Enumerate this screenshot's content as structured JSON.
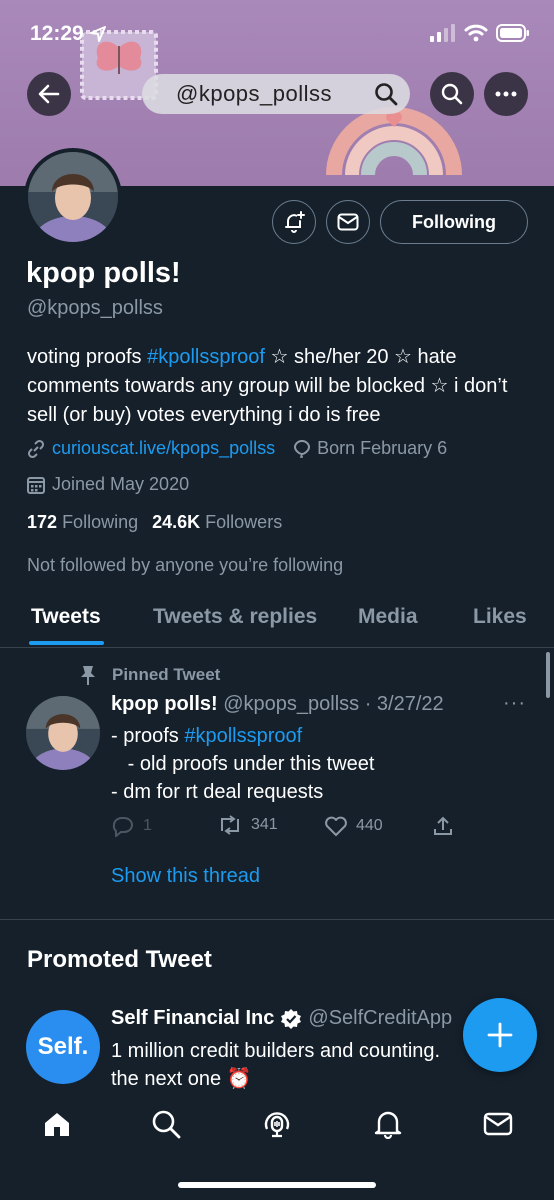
{
  "status_bar": {
    "time": "12:29"
  },
  "header": {
    "search_text": "@kpops_pollss"
  },
  "profile": {
    "name": "kpop polls!",
    "handle": "@kpops_pollss",
    "follow_label": "Following",
    "bio_prefix": "voting proofs ",
    "bio_hashtag": "#kpollssproof",
    "bio_suffix": " ☆ she/her 20 ☆ hate comments towards any group will be blocked ☆ i don’t sell (or buy) votes everything i do is free",
    "website": "curiouscat.live/kpops_pollss",
    "birthday": "Born February 6",
    "joined": "Joined May 2020",
    "following_count": "172",
    "following_label": "Following",
    "followers_count": "24.6K",
    "followers_label": "Followers",
    "not_followed": "Not followed by anyone you’re following"
  },
  "tabs": [
    {
      "label": "Tweets"
    },
    {
      "label": "Tweets & replies"
    },
    {
      "label": "Media"
    },
    {
      "label": "Likes"
    }
  ],
  "pinned_tweet": {
    "pinned_label": "Pinned Tweet",
    "author_name": "kpop polls!",
    "meta": "@kpops_pollss · 3/27/22",
    "line1_prefix": "- proofs ",
    "line1_hashtag": "#kpollssproof",
    "line2": "   - old proofs under this tweet",
    "line3": "- dm for rt deal requests",
    "replies": "1",
    "retweets": "341",
    "likes": "440",
    "show_thread": "Show this thread"
  },
  "promoted": {
    "title": "Promoted Tweet",
    "logo_text": "Self.",
    "author_name": "Self Financial Inc",
    "handle": "@SelfCreditApp",
    "body": "1 million credit builders and counting.\nthe next one ⏰"
  },
  "colors": {
    "background": "#15202b",
    "accent": "#1d9bf0",
    "muted": "#8b98a5",
    "banner": "#a989b9"
  }
}
